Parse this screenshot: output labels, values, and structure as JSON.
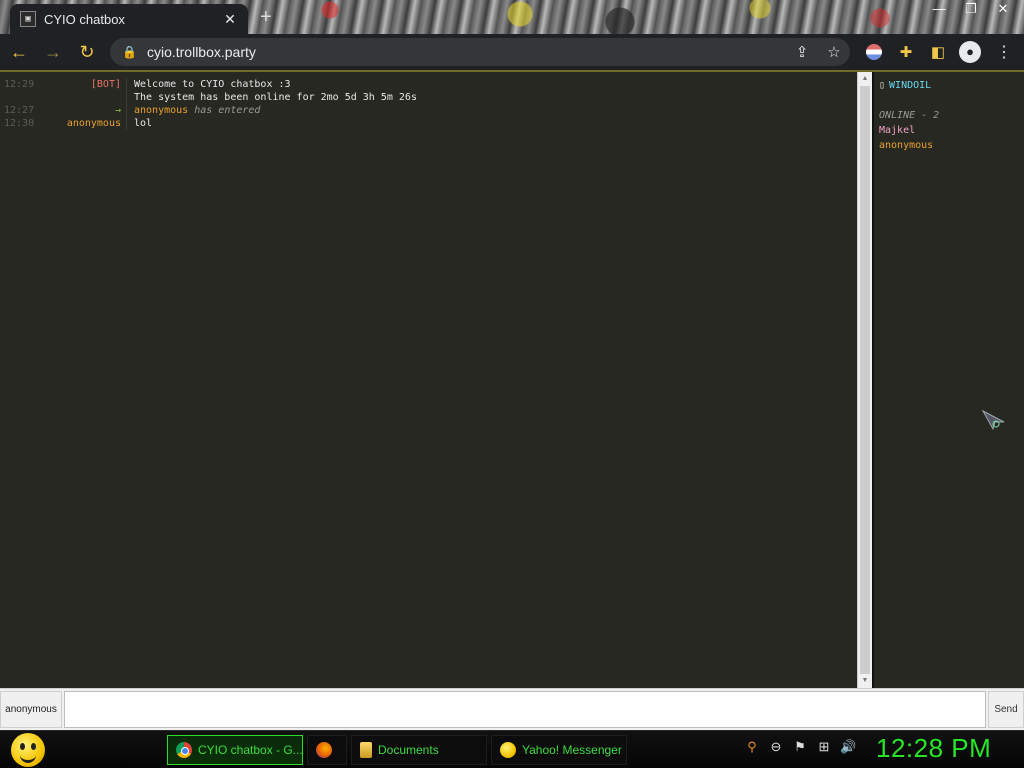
{
  "browser": {
    "tab_title": "CYIO chatbox",
    "new_tab_icon": "+",
    "url": "cyio.trollbox.party"
  },
  "chat": {
    "messages": [
      {
        "time": "12:29",
        "nick": "[BOT]",
        "text": "Welcome to CYIO chatbox :3"
      },
      {
        "time": "",
        "nick": "",
        "text": "The system has been online for 2mo 5d 3h 5m 26s"
      },
      {
        "time": "12:27",
        "nick": "→",
        "name": "anonymous",
        "action": "has entered"
      },
      {
        "time": "12:30",
        "nick": "anonymous",
        "text": "lol"
      }
    ]
  },
  "sidebar": {
    "room": "WINDOIL",
    "online_label": "ONLINE - 2",
    "users": [
      "Majkel",
      "anonymous"
    ]
  },
  "input": {
    "nick_button": "anonymous",
    "message_value": "",
    "send_label": "Send"
  },
  "taskbar": {
    "items": [
      {
        "label": "CYIO chatbox - G...",
        "icon": "chrome-icon",
        "active": true
      },
      {
        "label": "",
        "icon": "firefox-icon",
        "active": false
      },
      {
        "label": "Documents",
        "icon": "folder-icon",
        "active": false
      },
      {
        "label": "Yahoo! Messenger",
        "icon": "yahoo-messenger-icon",
        "active": false
      }
    ],
    "clock": "12:28 PM"
  },
  "colors": {
    "page_bg": "#272822",
    "bot_nick": "#e9746a",
    "anon_nick": "#e8a02c",
    "arrow": "#7ec63f",
    "room": "#66d9ef",
    "majkel": "#f2a0c8",
    "taskbar_text": "#3ddc3d",
    "clock": "#27e627"
  }
}
